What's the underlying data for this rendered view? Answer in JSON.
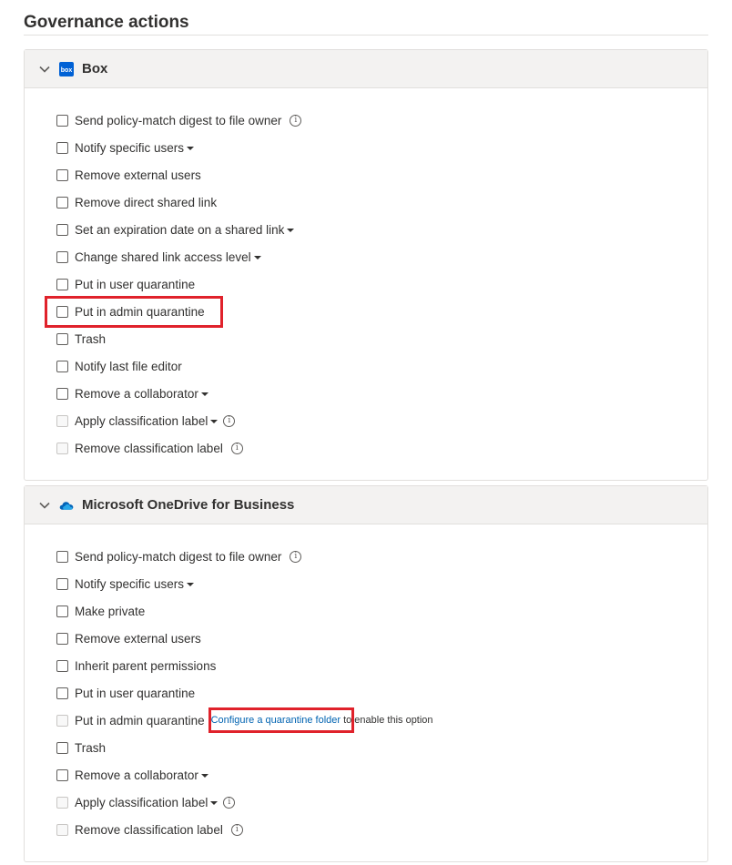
{
  "page_title": "Governance actions",
  "colors": {
    "highlight": "#e0222b",
    "link": "#0063b1",
    "box_brand": "#0061d5",
    "onedrive_brand": "#0364b8"
  },
  "box": {
    "title": "Box",
    "icon_text": "box",
    "items": [
      {
        "label": "Send policy-match digest to file owner",
        "info": true
      },
      {
        "label": "Notify specific users",
        "caret": true
      },
      {
        "label": "Remove external users"
      },
      {
        "label": "Remove direct shared link"
      },
      {
        "label": "Set an expiration date on a shared link",
        "caret": true
      },
      {
        "label": "Change shared link access level",
        "caret": true
      },
      {
        "label": "Put in user quarantine"
      },
      {
        "label": "Put in admin quarantine",
        "highlighted": true
      },
      {
        "label": "Trash"
      },
      {
        "label": "Notify last file editor"
      },
      {
        "label": "Remove a collaborator",
        "caret": true
      },
      {
        "label": "Apply classification label",
        "caret": true,
        "info": true,
        "disabled": true
      },
      {
        "label": "Remove classification label",
        "info": true,
        "disabled": true
      }
    ]
  },
  "onedrive": {
    "title": "Microsoft OneDrive for Business",
    "items": [
      {
        "label": "Send policy-match digest to file owner",
        "info": true
      },
      {
        "label": "Notify specific users",
        "caret": true
      },
      {
        "label": "Make private"
      },
      {
        "label": "Remove external users"
      },
      {
        "label": "Inherit parent permissions"
      },
      {
        "label": "Put in user quarantine"
      },
      {
        "label": "Put in admin quarantine",
        "disabled": true,
        "link": "Configure a quarantine folder",
        "after_link": "to enable this option"
      },
      {
        "label": "Trash"
      },
      {
        "label": "Remove a collaborator",
        "caret": true
      },
      {
        "label": "Apply classification label",
        "caret": true,
        "info": true,
        "disabled": true
      },
      {
        "label": "Remove classification label",
        "info": true,
        "disabled": true
      }
    ]
  }
}
